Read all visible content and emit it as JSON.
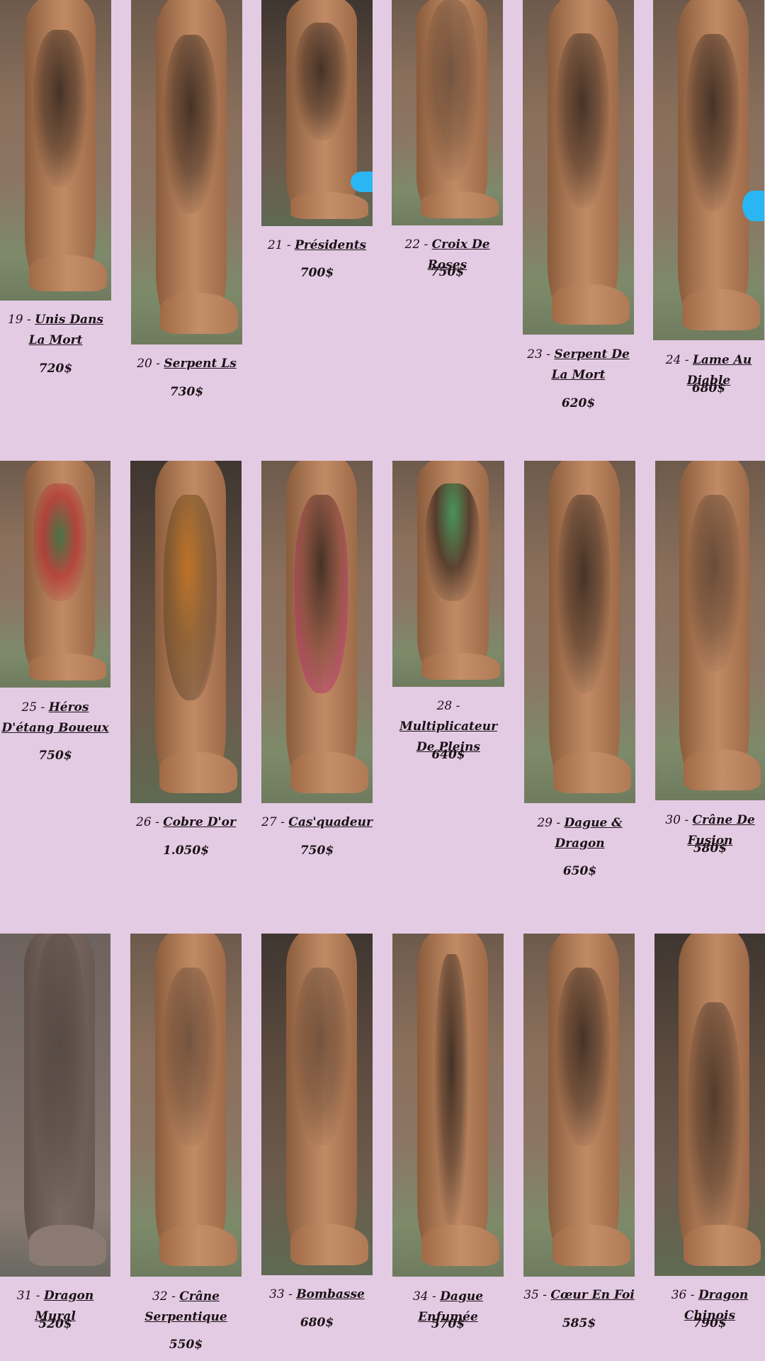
{
  "items": [
    {
      "num": "19",
      "name": "Unis Dans La Mort",
      "price": "720$"
    },
    {
      "num": "20",
      "name": "Serpent Ls",
      "price": "730$"
    },
    {
      "num": "21",
      "name": "Présidents",
      "price": "700$"
    },
    {
      "num": "22",
      "name": "Croix De Roses",
      "price": "750$"
    },
    {
      "num": "23",
      "name": "Serpent De La Mort",
      "price": "620$"
    },
    {
      "num": "24",
      "name": "Lame Au Diable",
      "price": "680$"
    },
    {
      "num": "25",
      "name": "Héros D'étang Boueux",
      "price": "750$"
    },
    {
      "num": "26",
      "name": "Cobre D'or",
      "price": "1.050$"
    },
    {
      "num": "27",
      "name": "Cas'quadeur",
      "price": "750$"
    },
    {
      "num": "28",
      "name": "Multiplicateur De Pleins",
      "price": "640$"
    },
    {
      "num": "29",
      "name": "Dague & Dragon",
      "price": "650$"
    },
    {
      "num": "30",
      "name": "Crâne De Fusion",
      "price": "580$"
    },
    {
      "num": "31",
      "name": "Dragon Mural",
      "price": "520$"
    },
    {
      "num": "32",
      "name": "Crâne Serpentique",
      "price": "550$"
    },
    {
      "num": "33",
      "name": "Bombasse",
      "price": "680$"
    },
    {
      "num": "34",
      "name": "Dague Enfumée",
      "price": "570$"
    },
    {
      "num": "35",
      "name": "Cœur En Foi",
      "price": "585$"
    },
    {
      "num": "36",
      "name": "Dragon Chinois",
      "price": "790$"
    }
  ],
  "separator": " - ",
  "colors": {
    "background": "#e4cbe4",
    "text": "#1a1216",
    "accent_blue": "#2ab6f2"
  }
}
